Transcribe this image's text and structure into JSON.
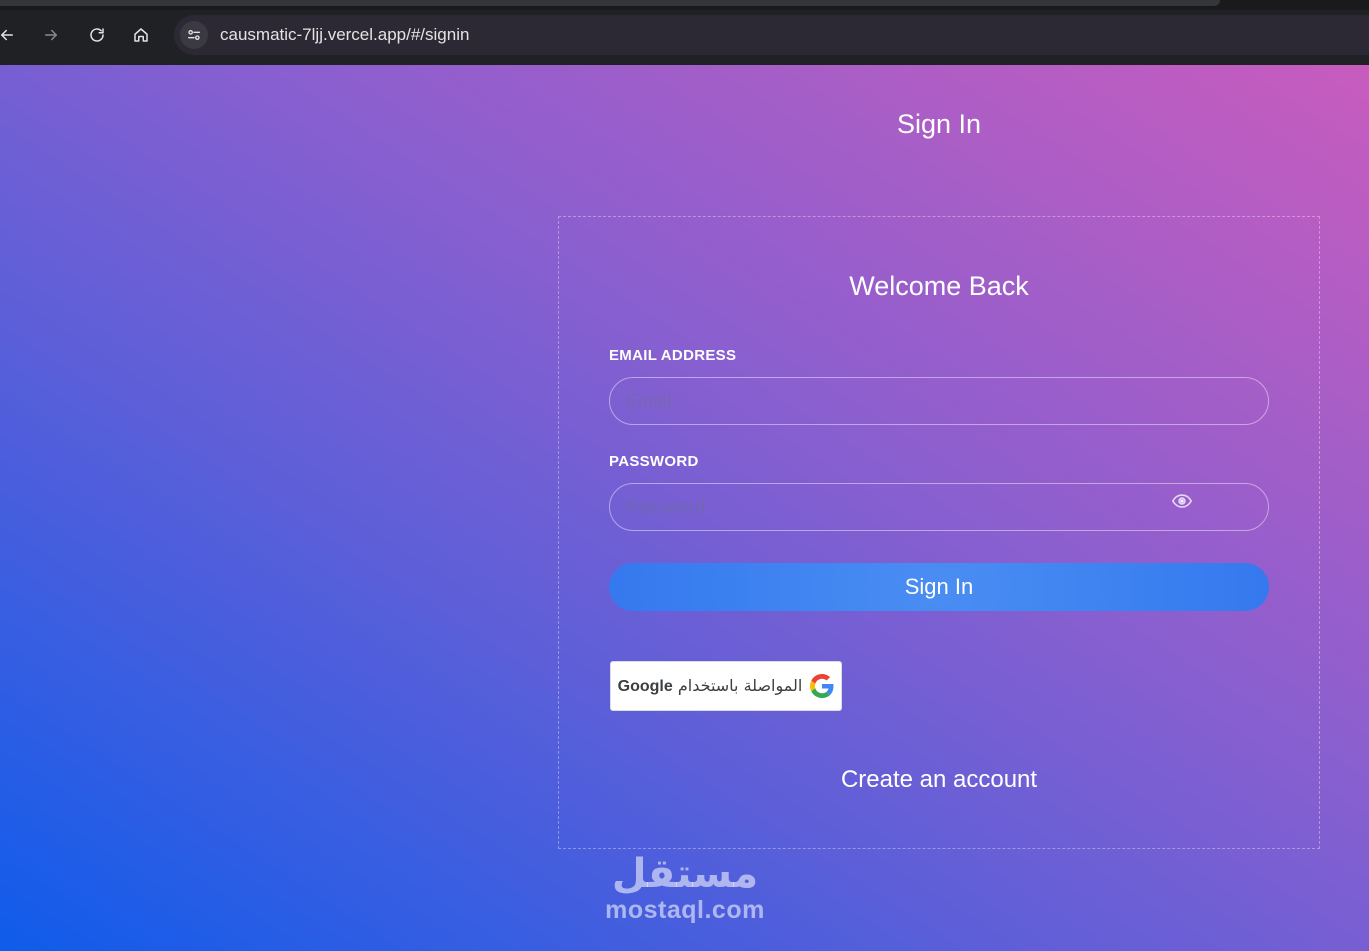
{
  "browser": {
    "url": "causmatic-7ljj.vercel.app/#/signin",
    "icons": {
      "back": "arrow-left-icon",
      "forward": "arrow-right-icon",
      "reload": "reload-icon",
      "home": "home-icon",
      "site_info": "tune-icon"
    }
  },
  "page": {
    "title": "Sign In"
  },
  "card": {
    "title": "Welcome Back",
    "email_label": "EMAIL ADDRESS",
    "email_placeholder": "Email",
    "password_label": "PASSWORD",
    "password_placeholder": "Password",
    "password_toggle_icon": "eye-icon",
    "signin_label": "Sign In",
    "google": {
      "label_ar": "المواصلة باستخدام",
      "label_brand": "Google",
      "icon": "google-logo-icon"
    },
    "create_account_label": "Create an account"
  },
  "watermark": {
    "arabic": "مستقل",
    "latin": "mostaql.com"
  },
  "colors": {
    "gradient_start": "#0f5ceb",
    "gradient_end": "#c85cbe",
    "button_blue": "#3a7ff0",
    "browser_bar": "#202124"
  }
}
